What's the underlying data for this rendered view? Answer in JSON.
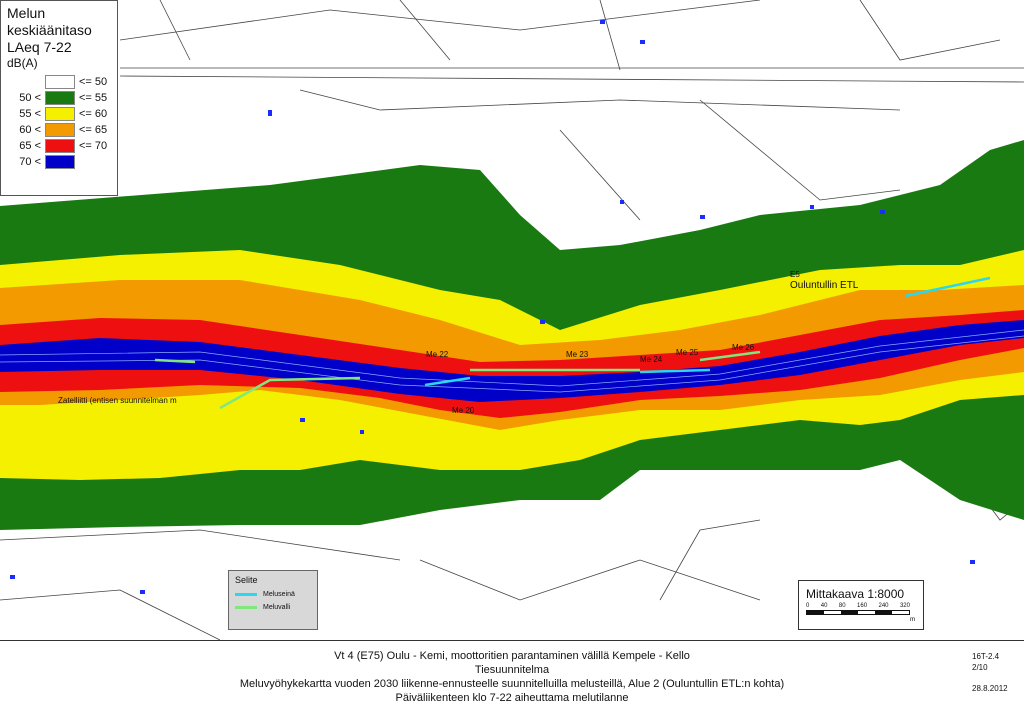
{
  "legend": {
    "title_lines": [
      "Melun",
      "keskiäänitaso",
      "LAeq 7-22"
    ],
    "unit": "dB(A)",
    "classes": [
      {
        "lower": "",
        "upper": "<= 50",
        "color": "#ffffff"
      },
      {
        "lower": "50 <",
        "upper": "<= 55",
        "color": "#1a7a12"
      },
      {
        "lower": "55 <",
        "upper": "<= 60",
        "color": "#f4f000"
      },
      {
        "lower": "60 <",
        "upper": "<= 65",
        "color": "#f29a00"
      },
      {
        "lower": "65 <",
        "upper": "<= 70",
        "color": "#ee1010"
      },
      {
        "lower": "70 <",
        "upper": "",
        "color": "#0000c8"
      }
    ]
  },
  "map_labels": {
    "me22": "Me 22",
    "me23": "Me 23",
    "me24": "Me 24",
    "me25": "Me 25",
    "me26": "Me 26",
    "me20": "Me 20",
    "e5": "E5",
    "ouluntulli": "Ouluntullin ETL",
    "zatelliitti": "Zatelliitti (entisen suunnitelman m"
  },
  "selite": {
    "title": "Selite",
    "items": [
      {
        "label": "Meluseinä",
        "color": "#29d8f0"
      },
      {
        "label": "Meluvalli",
        "color": "#7ee87e"
      }
    ]
  },
  "scale": {
    "title": "Mittakaava 1:8000",
    "ticks": [
      "0",
      "40",
      "80",
      "160",
      "240",
      "320"
    ],
    "unit": "m"
  },
  "footer": {
    "line1": "Vt 4 (E75) Oulu - Kemi, moottoritien parantaminen välillä Kempele - Kello",
    "line2": "Tiesuunnitelma",
    "line3": "Meluvyöhykekartta vuoden 2030 liikenne-ennusteelle suunnitelluilla melusteillä, Alue 2 (Ouluntullin ETL:n kohta)",
    "line4": "Päiväliikenteen klo 7-22 aiheuttama melutilanne",
    "code": "16T-2.4",
    "sheet": "2/10",
    "date": "28.8.2012"
  }
}
